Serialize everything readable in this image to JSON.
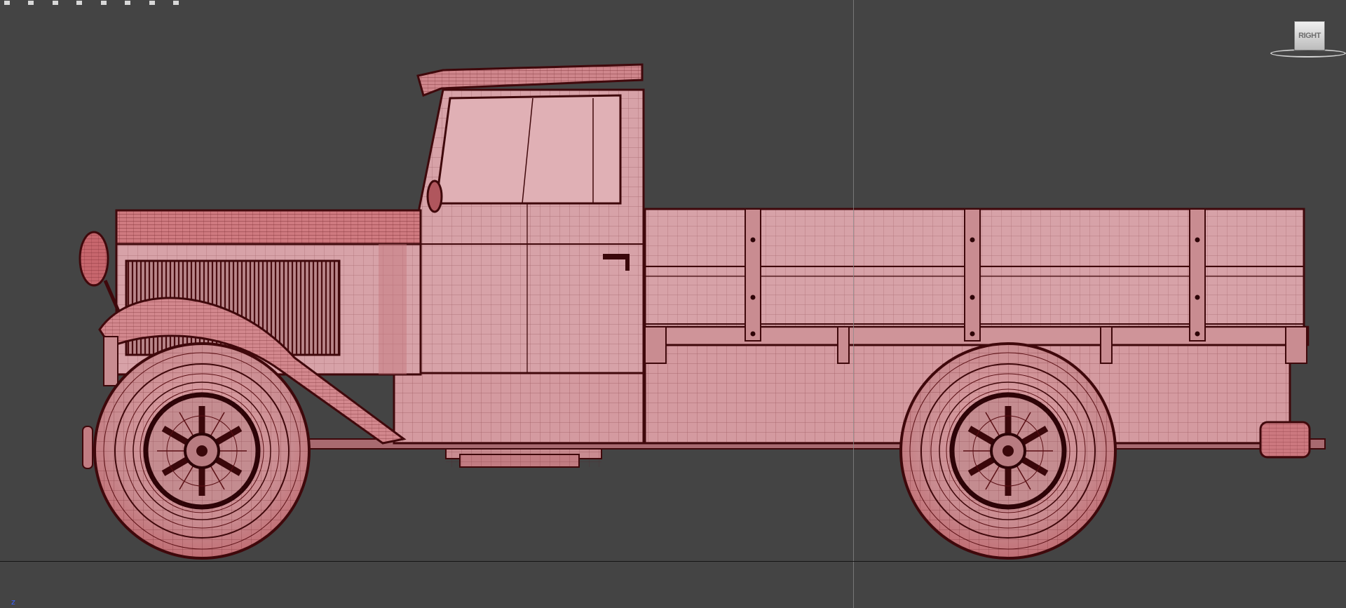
{
  "viewport": {
    "view_label": "RIGHT",
    "axis_label": "z"
  },
  "colors": {
    "background": "#444444",
    "mesh_fill": "#d49aa0",
    "mesh_dark": "#c4737a",
    "wireframe": "#5a0f14",
    "accent": "#c0505a"
  },
  "model": {
    "shading": "wireframe-over-shaded",
    "parts": [
      "cab",
      "hood",
      "grille",
      "headlight",
      "front-fender",
      "cargo-bed",
      "bed-side-posts",
      "front-wheel",
      "rear-wheel",
      "tail-light",
      "fuel-tank"
    ]
  }
}
